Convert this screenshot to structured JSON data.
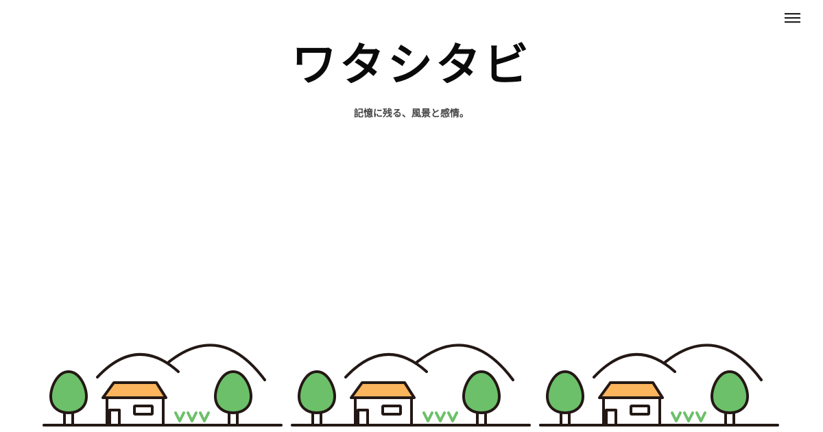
{
  "header": {
    "title": "ワタシタビ",
    "tagline": "記憶に残る、風景と感情。"
  },
  "menu": {
    "icon": "hamburger-menu-icon"
  },
  "illustration": {
    "motif": "house-trees-hills",
    "repeat_count": 3,
    "colors": {
      "outline": "#231815",
      "tree_fill": "#6cc069",
      "roof_fill": "#fbb55d",
      "grass": "#6cc069",
      "house_fill": "#ffffff"
    }
  }
}
